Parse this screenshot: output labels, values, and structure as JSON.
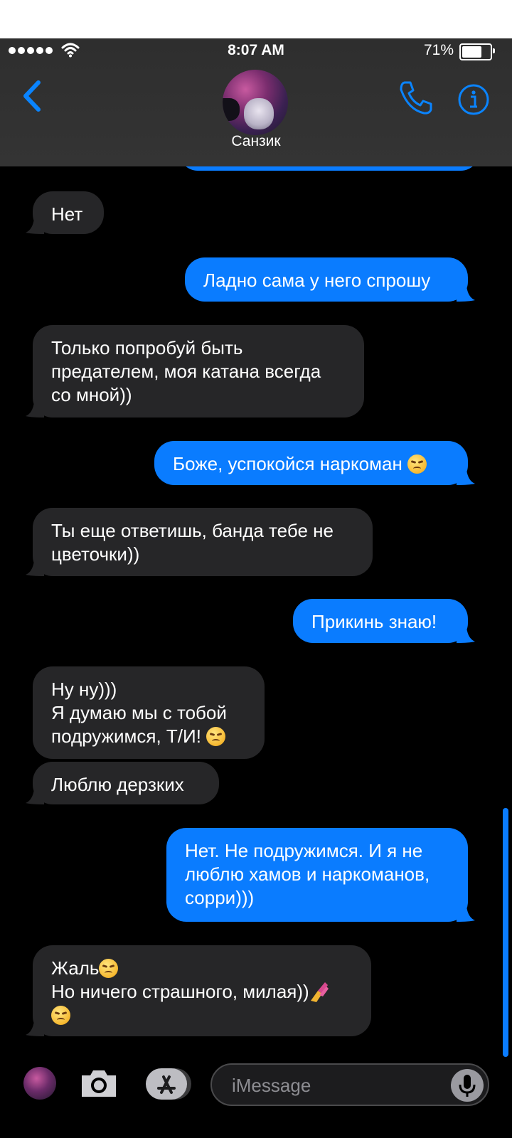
{
  "status_bar": {
    "time": "8:07 AM",
    "battery_percent": "71%",
    "battery_level": 0.71
  },
  "header": {
    "contact_name": "Санзик"
  },
  "colors": {
    "outgoing": "#0a7cff",
    "incoming": "#262628",
    "background": "#000000"
  },
  "messages": [
    {
      "direction": "incoming",
      "lines": [
        "Нет"
      ]
    },
    {
      "direction": "outgoing",
      "lines": [
        "Ладно сама у него спрошу"
      ]
    },
    {
      "direction": "incoming",
      "lines": [
        "Только попробуй быть",
        "предателем, моя катана всегда",
        "со мной))"
      ]
    },
    {
      "direction": "outgoing",
      "lines": [
        "Боже, успокойся наркоман"
      ],
      "emoji": "confounded-face"
    },
    {
      "direction": "incoming",
      "lines": [
        "Ты еще ответишь, банда тебе не",
        "цветочки))"
      ]
    },
    {
      "direction": "outgoing",
      "lines": [
        "Прикинь знаю!"
      ]
    },
    {
      "direction": "incoming",
      "lines": [
        "Ну ну)))",
        "Я думаю мы с тобой",
        "подружимся, Т/И!"
      ],
      "emoji": "smirking-face"
    },
    {
      "direction": "incoming",
      "lines": [
        "Люблю дерзких"
      ]
    },
    {
      "direction": "outgoing",
      "lines": [
        "Нет. Не подружимся. И я не",
        "люблю хамов и наркоманов,",
        "сорри)))"
      ]
    },
    {
      "direction": "incoming",
      "lines": [
        "Жаль",
        "Но ничего страшного, милая))"
      ],
      "emoji": [
        "confounded-face",
        "nail-polish",
        "smirking-face"
      ]
    }
  ],
  "composer": {
    "placeholder": "iMessage"
  }
}
